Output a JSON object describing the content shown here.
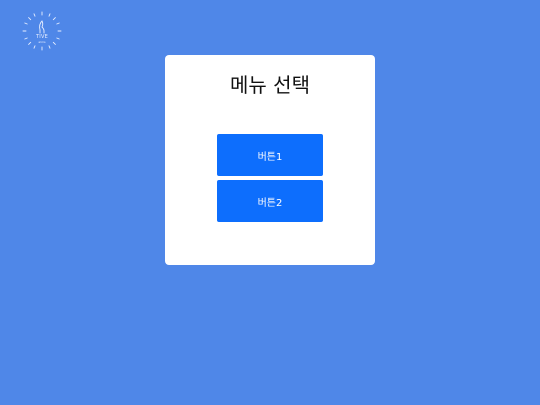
{
  "logo": {
    "icon": "clock-lion-logo-icon",
    "text": "TIVE",
    "subtext": "alms"
  },
  "card": {
    "title": "메뉴 선택"
  },
  "buttons": [
    {
      "label": "버튼1"
    },
    {
      "label": "버튼2"
    }
  ],
  "colors": {
    "background": "#4f87e8",
    "card": "#ffffff",
    "button": "#0d6efd"
  }
}
